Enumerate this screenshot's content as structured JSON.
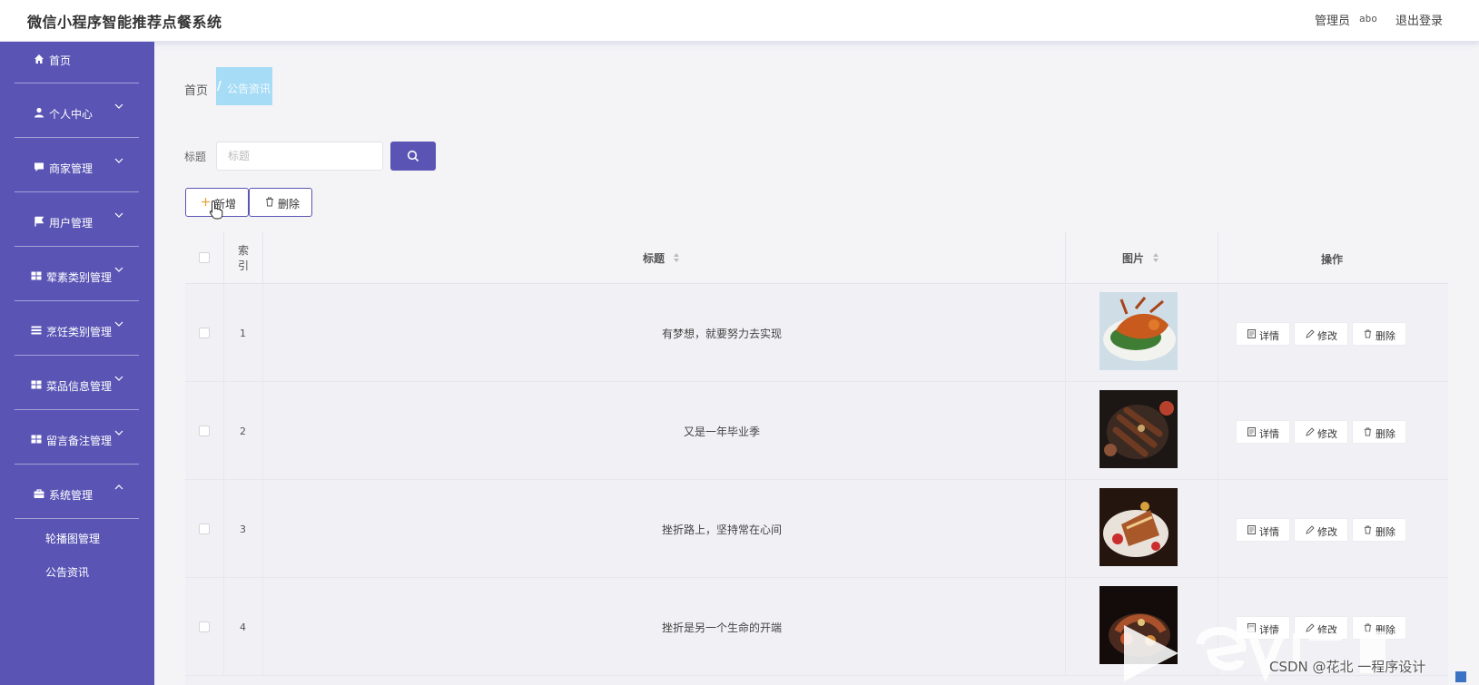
{
  "header": {
    "app_title": "微信小程序智能推荐点餐系统",
    "admin_label": "管理员",
    "admin_name": "abo",
    "logout_label": "退出登录"
  },
  "sidebar": {
    "items": [
      {
        "label": "首页",
        "icon": "home-icon"
      },
      {
        "label": "个人中心",
        "icon": "user-icon"
      },
      {
        "label": "商家管理",
        "icon": "chat-icon"
      },
      {
        "label": "用户管理",
        "icon": "flag-icon"
      },
      {
        "label": "荤素类别管理",
        "icon": "grid-icon"
      },
      {
        "label": "烹饪类别管理",
        "icon": "list-icon"
      },
      {
        "label": "菜品信息管理",
        "icon": "grid-icon"
      },
      {
        "label": "留言备注管理",
        "icon": "grid-icon"
      },
      {
        "label": "系统管理",
        "icon": "briefcase-icon"
      }
    ],
    "sub_items": [
      {
        "label": "轮播图管理"
      },
      {
        "label": "公告资讯"
      }
    ]
  },
  "breadcrumb": {
    "home": "首页",
    "separator": "/",
    "current": "公告资讯"
  },
  "search": {
    "label": "标题",
    "placeholder": "标题",
    "value": ""
  },
  "toolbar": {
    "add_label": "新增",
    "delete_label": "删除"
  },
  "table": {
    "columns": {
      "index": "索\n引",
      "title": "标题",
      "image": "图片",
      "actions": "操作"
    },
    "rows": [
      {
        "index": "1",
        "title": "有梦想，就要努力去实现"
      },
      {
        "index": "2",
        "title": "又是一年毕业季"
      },
      {
        "index": "3",
        "title": "挫折路上，坚持常在心间"
      },
      {
        "index": "4",
        "title": "挫折是另一个生命的开端"
      }
    ],
    "actions": {
      "detail": "详情",
      "edit": "修改",
      "delete": "删除"
    }
  },
  "watermark": {
    "text": "CSDN @花北 一程序设计"
  },
  "colors": {
    "primary": "#5a55b5",
    "breadcrumb_highlight": "#a6dcf6",
    "page_bg": "#f4f4f6"
  }
}
